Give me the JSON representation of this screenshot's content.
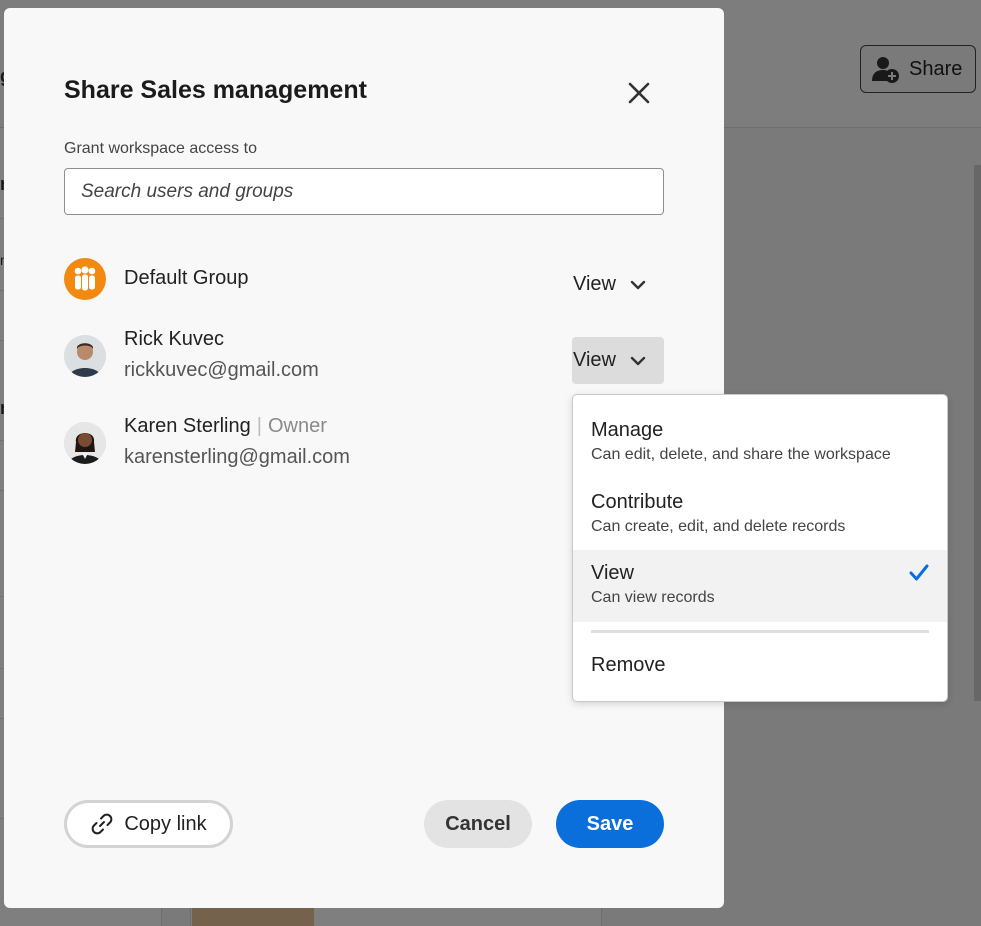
{
  "background": {
    "share_label": "Share",
    "edge_chars": [
      "g",
      "r",
      "n",
      "n"
    ]
  },
  "dialog": {
    "title": "Share Sales management",
    "grant_label": "Grant workspace access to",
    "search_placeholder": "Search users and groups",
    "members": [
      {
        "name": "Default Group",
        "email": "",
        "role": "View",
        "avatar": "group-icon"
      },
      {
        "name": "Rick Kuvec",
        "email": "rickkuvec@gmail.com",
        "role": "View",
        "avatar": "user-photo"
      },
      {
        "name": "Karen Sterling",
        "separator": "|",
        "owner_label": "Owner",
        "email": "karensterling@gmail.com",
        "avatar": "user-photo"
      }
    ],
    "copy_link_label": "Copy link",
    "cancel_label": "Cancel",
    "save_label": "Save"
  },
  "role_menu": {
    "items": [
      {
        "label": "Manage",
        "description": "Can edit, delete, and share the workspace",
        "selected": false
      },
      {
        "label": "Contribute",
        "description": "Can create, edit, and delete records",
        "selected": false
      },
      {
        "label": "View",
        "description": "Can view records",
        "selected": true
      }
    ],
    "remove_label": "Remove"
  },
  "colors": {
    "accent": "#0a6fdb",
    "group_avatar": "#f28a12",
    "check": "#0a6fdb"
  }
}
